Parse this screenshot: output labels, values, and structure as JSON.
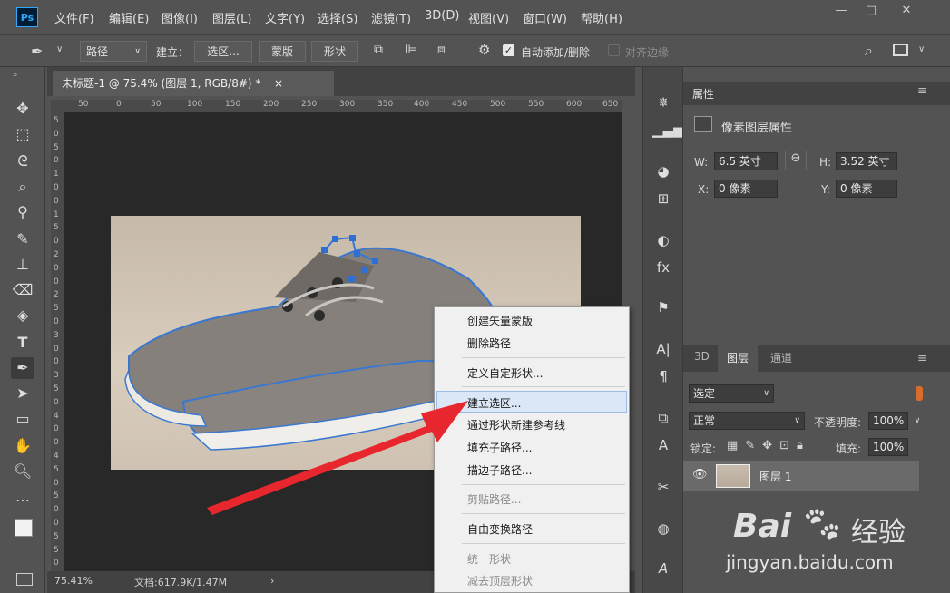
{
  "menubar": {
    "logo": "Ps",
    "items": [
      "文件(F)",
      "编辑(E)",
      "图像(I)",
      "图层(L)",
      "文字(Y)",
      "选择(S)",
      "滤镜(T)",
      "3D(D)",
      "视图(V)",
      "窗口(W)",
      "帮助(H)"
    ],
    "window_buttons": [
      "—",
      "□",
      "✕"
    ]
  },
  "options": {
    "mode_select": "路径",
    "make_label": "建立：",
    "selection_btn": "选区...",
    "mask_btn": "蒙版",
    "shape_btn": "形状",
    "auto_add": "自动添加/删除",
    "align_edges": "对齐边缘"
  },
  "document": {
    "tab_title": "未标题-1 @ 75.4% (图层 1, RGB/8#) *",
    "tab_close": "×",
    "ruler_ticks": [
      "50",
      "0",
      "50",
      "100",
      "150",
      "200",
      "250",
      "300",
      "350",
      "400",
      "450",
      "500",
      "550",
      "600",
      "650"
    ],
    "ruler_v": [
      "5",
      "0",
      "5",
      "0",
      "1",
      "0",
      "0",
      "1",
      "5",
      "0",
      "2",
      "0",
      "0",
      "2",
      "5",
      "0",
      "3",
      "0",
      "0",
      "3",
      "5",
      "0",
      "4",
      "0",
      "0",
      "4",
      "5",
      "0",
      "5",
      "0",
      "0",
      "5",
      "5",
      "0"
    ],
    "zoom": "75.41%",
    "doc_info": "文档:617.9K/1.47M"
  },
  "properties": {
    "title": "属性",
    "subtitle": "像素图层属性",
    "w_label": "W:",
    "w_value": "6.5 英寸",
    "h_label": "H:",
    "h_value": "3.52 英寸",
    "x_label": "X:",
    "x_value": "0 像素",
    "y_label": "Y:",
    "y_value": "0 像素"
  },
  "layers": {
    "tabs": [
      "3D",
      "图层",
      "通道"
    ],
    "filter": "选定",
    "blend_mode": "正常",
    "opacity_label": "不透明度:",
    "opacity": "100%",
    "lock_label": "锁定:",
    "fill_label": "填充:",
    "fill": "100%",
    "layer_name": "图层 1"
  },
  "context_menu": {
    "items": [
      {
        "label": "创建矢量蒙版",
        "disabled": false
      },
      {
        "label": "删除路径",
        "disabled": false
      },
      {
        "label": "定义自定形状...",
        "disabled": false
      },
      {
        "label": "建立选区...",
        "disabled": false,
        "highlighted": true
      },
      {
        "label": "通过形状新建参考线",
        "disabled": false
      },
      {
        "label": "填充子路径...",
        "disabled": false
      },
      {
        "label": "描边子路径...",
        "disabled": false
      },
      {
        "label": "剪贴路径...",
        "disabled": true
      },
      {
        "label": "自由变换路径",
        "disabled": false
      },
      {
        "label": "统一形状",
        "disabled": true
      },
      {
        "label": "减去顶层形状",
        "disabled": true
      }
    ]
  },
  "watermark": {
    "brand": "Bai",
    "brand2": "经验",
    "url": "jingyan.baidu.com"
  },
  "colors": {
    "accent": "#31a8ff",
    "path_blue": "#3a78d0",
    "arrow_red": "#e8262d"
  }
}
